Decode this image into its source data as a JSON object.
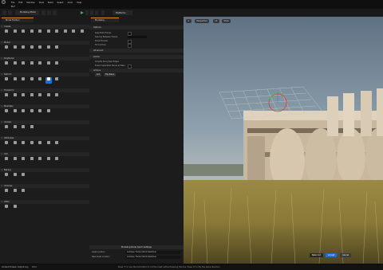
{
  "menu": {
    "items": [
      "File",
      "Edit",
      "Window",
      "Tools",
      "Build",
      "Select",
      "Actor",
      "Help"
    ],
    "project": "Bu*"
  },
  "toolbar": {
    "mode": "Modeling Mode",
    "platforms": "Platforms"
  },
  "left": {
    "tab": "Mode Toolbox",
    "categories": [
      {
        "name": "Create",
        "tools": [
          "Box",
          "Sphere",
          "Cyl",
          "Cone",
          "Torus",
          "Arrow",
          "Rect",
          "Disc",
          "Stair",
          "Capsule"
        ]
      },
      {
        "name": "Model",
        "tools": [
          "PolyExt",
          "PolyRev",
          "Path",
          "Revolve",
          "Loft",
          "Pen",
          "Cube Grid"
        ]
      },
      {
        "name": "PolyModel",
        "tools": [
          "PolyGrp",
          "TriSel",
          "Insert",
          "Inset",
          "Extrude",
          "Cut",
          "Bevel"
        ]
      },
      {
        "name": "Deform",
        "tools": [
          "VSculpt",
          "DSculpt",
          "Smooth",
          "Offset",
          "Warp",
          "Lattice",
          "Displace"
        ]
      },
      {
        "name": "Transform",
        "tools": [
          "XForm",
          "Align",
          "Pivot",
          "PlcPvt",
          "BakeRS",
          "Mirror",
          "Edit"
        ]
      },
      {
        "name": "MeshOps",
        "tools": [
          "Simplify",
          "Remesh",
          "Weld",
          "Jacket",
          "Boolean",
          "Union"
        ]
      },
      {
        "name": "VoxOps",
        "tools": [
          "VoxWrap",
          "VoxBlnd",
          "VoxMrg",
          "VoxBool"
        ]
      },
      {
        "name": "Attributes",
        "tools": [
          "Inspect",
          "Normals",
          "Tngnt",
          "AttrEd",
          "Materials",
          "NrmMap",
          "PolyGrp"
        ]
      },
      {
        "name": "UVs",
        "tools": [
          "UVProj",
          "AutoUV",
          "UVSeam",
          "Layout",
          "Transfer",
          "UVEdit",
          "Unwrap"
        ]
      },
      {
        "name": "Baking",
        "tools": [
          "BakeTx",
          "BakeAll",
          "BakeVtx"
        ]
      },
      {
        "name": "Volumes",
        "tools": [
          "Vol2Msh",
          "Msh2Vol",
          "BspConv"
        ]
      },
      {
        "name": "LODs",
        "tools": [
          "LODMgr",
          "Gen LOD"
        ]
      }
    ]
  },
  "middle": {
    "tab": "Modeling",
    "sections": {
      "options": "Options",
      "advanced": "Advanced",
      "gizmo": "Gizmo",
      "actions": "Actions"
    },
    "rows": [
      "Keep Both Halves",
      "Spacing Between Halves",
      "Show Preview",
      "Fill Cut Hole",
      "Simplify Along New Edges",
      "Export Separated Pieces as New..."
    ],
    "advanced_rows": [
      "Snap to Grid"
    ],
    "buttons": [
      "Cut",
      "Flip Plane"
    ],
    "quick_settings": {
      "title": "Modeling Mode Quick Settings",
      "rows": [
        {
          "label": "Asset Location",
          "value": "AutoGen Folder (World-Relative)"
        },
        {
          "label": "New Asset Location",
          "value": "AutoGen Folder (World-Relative)"
        }
      ]
    }
  },
  "viewport": {
    "controls": [
      "Perspective",
      "Lit",
      "Show"
    ],
    "accept": "Accept",
    "cancel": "Cancel",
    "gen": "Bake Cut"
  },
  "status": {
    "items": [
      "Content Drawer",
      "Output Log",
      "Cmd"
    ],
    "hint": "Press 'T' or use the Cut button to cut the mesh without leaving the tool. Press 'R' to flip the plane direction."
  },
  "colors": {
    "accent": "#1f6fd1",
    "play": "#3cb24a"
  }
}
